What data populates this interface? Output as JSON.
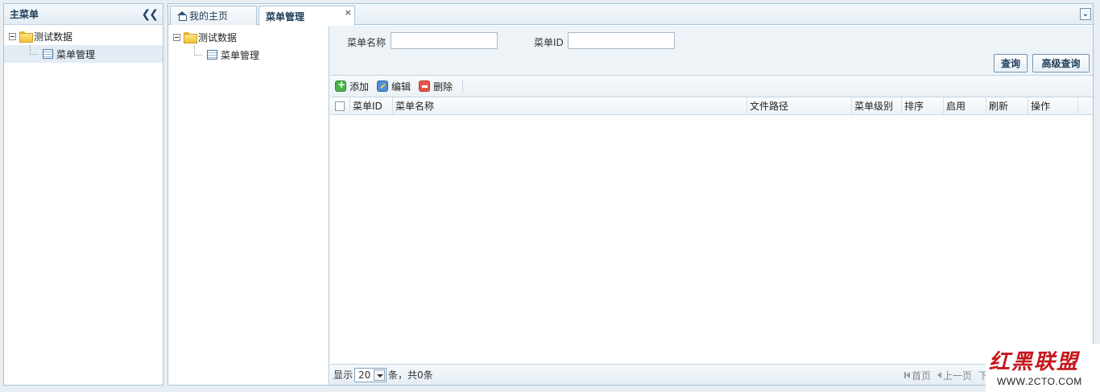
{
  "left_panel": {
    "title": "主菜单",
    "collapse_icon": "double-chevron-left-icon",
    "tree": [
      {
        "label": "测试数据",
        "type": "folder"
      },
      {
        "label": "菜单管理",
        "type": "file"
      }
    ]
  },
  "tabs": [
    {
      "label": "我的主页",
      "icon": "home-icon"
    },
    {
      "label": "菜单管理",
      "active": true
    }
  ],
  "tab_close": "×",
  "tab_menu_icon": "double-chevron-down-icon",
  "tab_menu_glyph": "⌄",
  "inner_tree": [
    {
      "label": "测试数据",
      "type": "folder"
    },
    {
      "label": "菜单管理",
      "type": "file"
    }
  ],
  "search": {
    "menu_name_label": "菜单名称",
    "menu_name_value": "",
    "menu_id_label": "菜单ID",
    "menu_id_value": "",
    "query_button": "查询",
    "advanced_query_button": "高级查询"
  },
  "toolbar": {
    "add": "添加",
    "edit": "编辑",
    "delete": "删除"
  },
  "grid": {
    "columns": [
      "菜单ID",
      "菜单名称",
      "文件路径",
      "菜单级别",
      "排序",
      "启用",
      "刷新",
      "操作"
    ],
    "rows": []
  },
  "pager": {
    "show_label": "显示",
    "page_size": "20",
    "summary": "条，共0条",
    "first": "首页",
    "prev": "上一页",
    "next": "下"
  },
  "watermark": {
    "title": "红黑联盟",
    "url": "WWW.2CTO.COM",
    "title_color": "#c4161c"
  }
}
